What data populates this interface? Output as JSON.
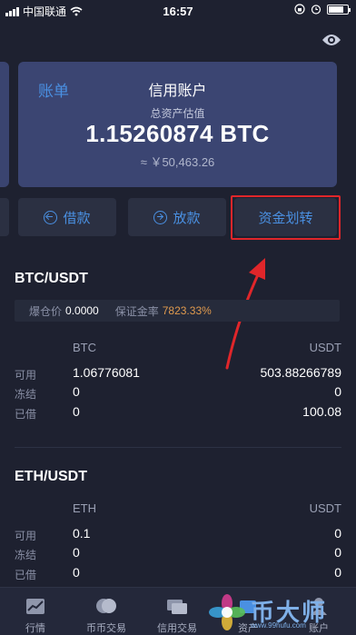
{
  "status_bar": {
    "carrier": "中国联通",
    "time": "16:57",
    "battery_level": 0.8
  },
  "account_card": {
    "link_label": "账单",
    "title": "信用账户",
    "subtitle": "总资产估值",
    "amount": "1.15260874 BTC",
    "fiat": "≈ ￥50,463.26"
  },
  "actions": {
    "borrow": "借款",
    "repay": "放款",
    "transfer": "资金划转"
  },
  "btc_section": {
    "pair": "BTC/USDT",
    "liquidation_label": "爆仓价",
    "liquidation_value": "0.0000",
    "margin_label": "保证金率",
    "margin_value": "7823.33%",
    "col_left": "BTC",
    "col_right": "USDT",
    "rows": [
      {
        "label": "可用",
        "left": "1.06776081",
        "right": "503.88266789"
      },
      {
        "label": "冻结",
        "left": "0",
        "right": "0"
      },
      {
        "label": "已借",
        "left": "0",
        "right": "100.08"
      }
    ]
  },
  "eth_section": {
    "pair": "ETH/USDT",
    "col_left": "ETH",
    "col_right": "USDT",
    "rows": [
      {
        "label": "可用",
        "left": "0.1",
        "right": "0"
      },
      {
        "label": "冻结",
        "left": "0",
        "right": "0"
      },
      {
        "label": "已借",
        "left": "0",
        "right": "0"
      }
    ]
  },
  "tabs": [
    {
      "label": "行情",
      "icon": "chart-icon"
    },
    {
      "label": "币币交易",
      "icon": "coin-exchange-icon"
    },
    {
      "label": "信用交易",
      "icon": "credit-trade-icon"
    },
    {
      "label": "资产",
      "icon": "assets-icon"
    },
    {
      "label": "账户",
      "icon": "account-icon"
    }
  ],
  "watermark": {
    "text": "币大师",
    "url": "www.99hufu.com"
  },
  "colors": {
    "background": "#1e2130",
    "card": "#3b4572",
    "accent_blue": "#4a90e2",
    "highlight_red": "#e0262a",
    "margin_orange": "#e09a4e"
  }
}
